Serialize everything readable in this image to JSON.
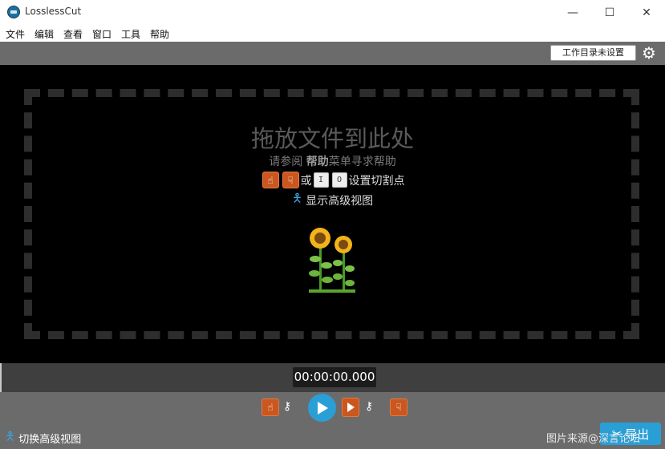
{
  "window": {
    "title": "LosslessCut",
    "minimize": "—",
    "maximize": "☐",
    "close": "✕"
  },
  "menu": [
    "文件",
    "编辑",
    "查看",
    "窗口",
    "工具",
    "帮助"
  ],
  "toolbar": {
    "workdir_label": "工作目录未设置",
    "settings_icon": "gear-icon"
  },
  "dropzone": {
    "title": "拖放文件到此处",
    "help_prefix": "请参阅 ",
    "help_bold": "帮助",
    "help_suffix": "菜单寻求帮助",
    "cut_or": "或",
    "key_start": "I",
    "key_end": "O",
    "cut_text": "设置切割点",
    "advanced_text": "显示高级视图"
  },
  "timeline": {
    "timecode": "00:00:00.000"
  },
  "bottom": {
    "toggle_advanced": "切换高级视图",
    "export_label": "导出",
    "watermark": "图片来源@深言论坛"
  },
  "colors": {
    "accent": "#2a9fd6",
    "cutpoint": "#c9571f",
    "panel": "#6b6b6b"
  }
}
